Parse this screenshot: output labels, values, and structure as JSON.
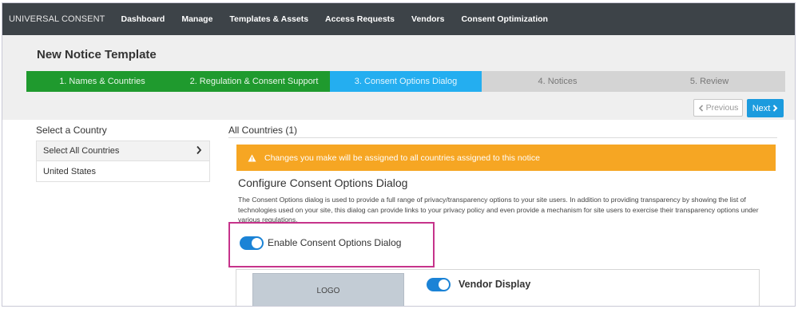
{
  "nav": {
    "brand": "UNIVERSAL CONSENT",
    "items": [
      "Dashboard",
      "Manage",
      "Templates & Assets",
      "Access Requests",
      "Vendors",
      "Consent Optimization"
    ]
  },
  "page": {
    "title": "New Notice Template"
  },
  "steps": [
    {
      "label": "1. Names & Countries",
      "state": "done"
    },
    {
      "label": "2. Regulation & Consent Support",
      "state": "done"
    },
    {
      "label": "3. Consent Options Dialog",
      "state": "active"
    },
    {
      "label": "4. Notices",
      "state": "todo"
    },
    {
      "label": "5. Review",
      "state": "todo"
    }
  ],
  "buttons": {
    "previous": "Previous",
    "next": "Next"
  },
  "countries": {
    "title": "Select a Country",
    "items": [
      "Select All Countries",
      "United States"
    ]
  },
  "content": {
    "header": "All Countries (1)",
    "warning": "Changes you make will be assigned to all countries assigned to this notice",
    "section_title": "Configure Consent Options Dialog",
    "section_desc": "The Consent Options dialog is used to provide a full range of privacy/transparency options to your site users. In addition to providing transparency by showing the list of technologies used on your site, this dialog can provide links to your privacy policy and even provide a mechanism for site users to exercise their transparency options under various regulations.",
    "enable_label": "Enable Consent Options Dialog",
    "enable_on": true
  },
  "preview": {
    "logo": "LOGO",
    "vendor_display": "Vendor Display",
    "vendor_on": true
  },
  "colors": {
    "step_done": "#1f9a2e",
    "step_active": "#24aef0",
    "step_todo": "#d4d4d4",
    "warning": "#f6a623",
    "toggle_on": "#1b83d6",
    "highlight": "#c6338b"
  },
  "icons": {
    "chevron": "chevron-right-icon",
    "warning": "warning-triangle-icon",
    "prev": "chevron-left-icon",
    "next": "chevron-right-icon"
  }
}
